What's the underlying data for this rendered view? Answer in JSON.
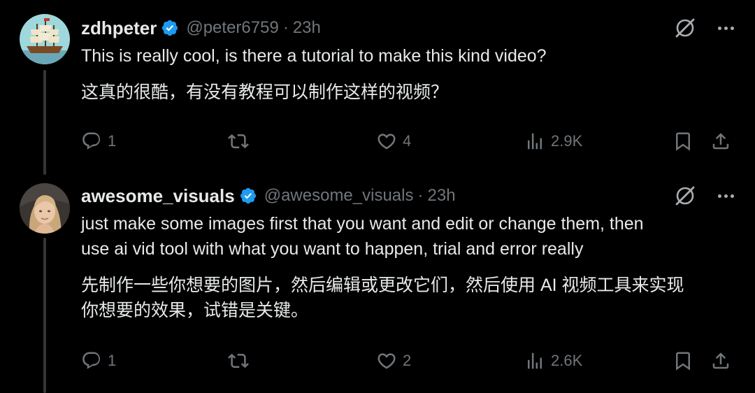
{
  "colors": {
    "background": "#000000",
    "text": "#e7e9ea",
    "muted": "#71767b",
    "verified": "#1d9bf0"
  },
  "posts": [
    {
      "name": "zdhpeter",
      "handle": "@peter6759",
      "separator": "·",
      "time": "23h",
      "avatar_icon": "ship-avatar",
      "text_lines": [
        "This is really cool, is there a tutorial to make this kind video?"
      ],
      "translation_lines": [
        "这真的很酷，有没有教程可以制作这样的视频？"
      ],
      "replies": "1",
      "retweets": "",
      "likes": "4",
      "views": "2.9K"
    },
    {
      "name": "awesome_visuals",
      "handle": "@awesome_visuals",
      "separator": "·",
      "time": "23h",
      "avatar_icon": "person-avatar",
      "text_lines": [
        "just make some images first that you want and edit or change them, then",
        "use ai vid tool with what you want to happen, trial and error really"
      ],
      "translation_lines": [
        "先制作一些你想要的图片，然后编辑或更改它们，然后使用 AI 视频工具来实现",
        "你想要的效果，试错是关键。"
      ],
      "replies": "1",
      "retweets": "",
      "likes": "2",
      "views": "2.6K"
    }
  ]
}
